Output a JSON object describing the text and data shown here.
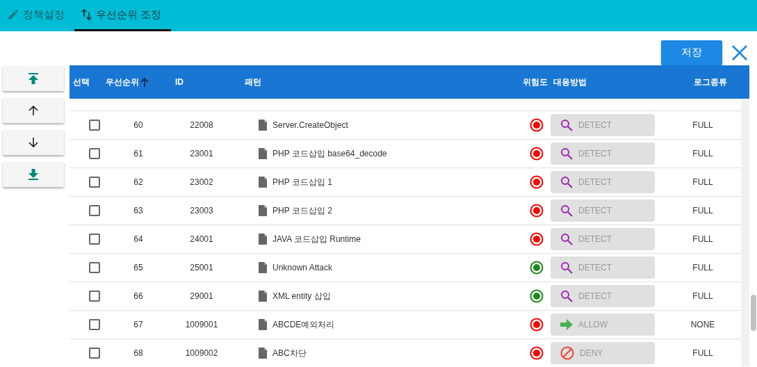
{
  "tabs": [
    {
      "label": "정책설정",
      "selected": false
    },
    {
      "label": "우선순위 조정",
      "selected": true
    }
  ],
  "toolbar": {
    "save": "저장"
  },
  "move_buttons": [
    {
      "kind": "top"
    },
    {
      "kind": "up"
    },
    {
      "kind": "down"
    },
    {
      "kind": "bottom"
    }
  ],
  "table": {
    "columns": [
      "선택",
      "우선순위",
      "ID",
      "패턴",
      "위험도",
      "대응방법",
      "로그종류"
    ],
    "rows": [
      {
        "checked": false,
        "priority": "60",
        "id": "22008",
        "pattern": "Server.CreateObject",
        "color": "#ff0000",
        "action": {
          "kind": "detect",
          "label": "DETECT"
        },
        "log": "FULL"
      },
      {
        "checked": false,
        "priority": "61",
        "id": "23001",
        "pattern": "PHP 코드삽입 base64_decode",
        "color": "#ff0000",
        "action": {
          "kind": "detect",
          "label": "DETECT"
        },
        "log": "FULL"
      },
      {
        "checked": false,
        "priority": "62",
        "id": "23002",
        "pattern": "PHP 코드삽입 1",
        "color": "#ff0000",
        "action": {
          "kind": "detect",
          "label": "DETECT"
        },
        "log": "FULL"
      },
      {
        "checked": false,
        "priority": "63",
        "id": "23003",
        "pattern": "PHP 코드삽입 2",
        "color": "#ff0000",
        "action": {
          "kind": "detect",
          "label": "DETECT"
        },
        "log": "FULL"
      },
      {
        "checked": false,
        "priority": "64",
        "id": "24001",
        "pattern": "JAVA 코드삽입 Runtime",
        "color": "#ff0000",
        "action": {
          "kind": "detect",
          "label": "DETECT"
        },
        "log": "FULL"
      },
      {
        "checked": false,
        "priority": "65",
        "id": "25001",
        "pattern": "Unknown Attack",
        "color": "#1b8a1b",
        "action": {
          "kind": "detect",
          "label": "DETECT"
        },
        "log": "FULL"
      },
      {
        "checked": false,
        "priority": "66",
        "id": "29001",
        "pattern": "XML entity 삽입",
        "color": "#1b8a1b",
        "action": {
          "kind": "detect",
          "label": "DETECT"
        },
        "log": "FULL"
      },
      {
        "checked": false,
        "priority": "67",
        "id": "1009001",
        "pattern": "ABCDE예외처리",
        "color": "#ff0000",
        "action": {
          "kind": "allow",
          "label": "ALLOW"
        },
        "log": "NONE"
      },
      {
        "checked": false,
        "priority": "68",
        "id": "1009002",
        "pattern": "ABC차단",
        "color": "#ff0000",
        "action": {
          "kind": "deny",
          "label": "DENY"
        },
        "log": "FULL"
      }
    ]
  }
}
